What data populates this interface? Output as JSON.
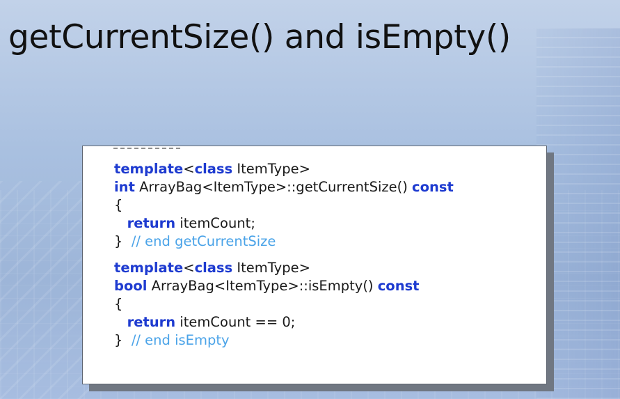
{
  "slide": {
    "title": "getCurrentSize() and isEmpty()"
  },
  "code": {
    "block1": {
      "l1_kw": "template",
      "l1_a": "<",
      "l1_kw2": "class",
      "l1_b": " ItemType>",
      "l2_kw": "int",
      "l2_a": " ArrayBag<ItemType>::getCurrentSize() ",
      "l2_kw2": "const",
      "l3": "{",
      "l4_indent": "   ",
      "l4_kw": "return",
      "l4_a": " itemCount;",
      "l5_a": "}  ",
      "l5_cm": "// end getCurrentSize"
    },
    "block2": {
      "l1_kw": "template",
      "l1_a": "<",
      "l1_kw2": "class",
      "l1_b": " ItemType>",
      "l2_kw": "bool",
      "l2_a": " ArrayBag<ItemType>::isEmpty() ",
      "l2_kw2": "const",
      "l3": "{",
      "l4_indent": "   ",
      "l4_kw": "return",
      "l4_a": " itemCount == 0;",
      "l5_a": "}  ",
      "l5_cm": "// end isEmpty"
    }
  },
  "colors": {
    "keyword": "#1e3bd0",
    "comment": "#4aa3e8",
    "background": "#a9c0e0"
  }
}
